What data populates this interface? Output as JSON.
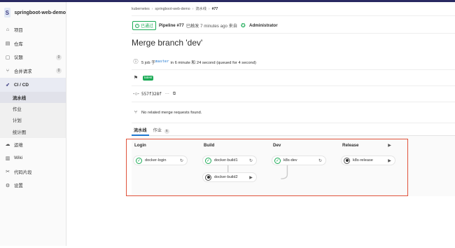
{
  "project": {
    "avatar_letter": "S",
    "name": "springboot-web-demo"
  },
  "sidebar": {
    "items": [
      {
        "label": "项目",
        "icon": "home-icon",
        "count": ""
      },
      {
        "label": "仓库",
        "icon": "book-icon",
        "count": ""
      },
      {
        "label": "议题",
        "icon": "issues-icon",
        "count": "0"
      },
      {
        "label": "合并请求",
        "icon": "merge-request-icon",
        "count": "0"
      },
      {
        "label": "CI / CD",
        "icon": "rocket-icon",
        "count": ""
      }
    ],
    "cicd_sub": [
      {
        "label": "流水线"
      },
      {
        "label": "作业"
      },
      {
        "label": "计划"
      },
      {
        "label": "统计图"
      }
    ],
    "items_after": [
      {
        "label": "运维",
        "icon": "cloud-icon"
      },
      {
        "label": "Wiki",
        "icon": "book-icon"
      },
      {
        "label": "代码片段",
        "icon": "scissors-icon"
      },
      {
        "label": "设置",
        "icon": "gear-icon"
      }
    ]
  },
  "breadcrumb": {
    "root": "kubernetes",
    "project": "springboot-web-demo",
    "section": "流水线",
    "current": "#77"
  },
  "pipeline": {
    "status": "已通过",
    "title": "Pipeline #77",
    "meta": "已触发 7 minutes ago 来自",
    "user": "Administrator"
  },
  "commit": {
    "title": "Merge branch 'dev'",
    "jobs_text_prefix": "5 job 于",
    "branch": "master",
    "jobs_text_suffix": "in 6 minute 和 24 second (queued for 4 second)",
    "tag": "latest",
    "sha": "557f328f",
    "ellipsis": "···",
    "mr_text": "No related merge requests found."
  },
  "tabs": [
    {
      "label": "流水线",
      "count": ""
    },
    {
      "label": "作业",
      "count": "5"
    }
  ],
  "stages": [
    {
      "name": "Login",
      "jobs": [
        {
          "name": "docker-login",
          "status": "passed",
          "action": "retry"
        }
      ]
    },
    {
      "name": "Build",
      "jobs": [
        {
          "name": "docker-build1",
          "status": "passed",
          "action": "retry"
        },
        {
          "name": "docker-build2",
          "status": "manual",
          "action": "play"
        }
      ]
    },
    {
      "name": "Dev",
      "jobs": [
        {
          "name": "k8s-dev",
          "status": "passed",
          "action": "retry"
        }
      ]
    },
    {
      "name": "Release",
      "jobs": [
        {
          "name": "k8s-release",
          "status": "manual",
          "action": "play"
        }
      ]
    }
  ],
  "colors": {
    "success": "#1aaa55",
    "link": "#1f78d1",
    "highlight": "#e0533b",
    "topbar": "#292961"
  }
}
